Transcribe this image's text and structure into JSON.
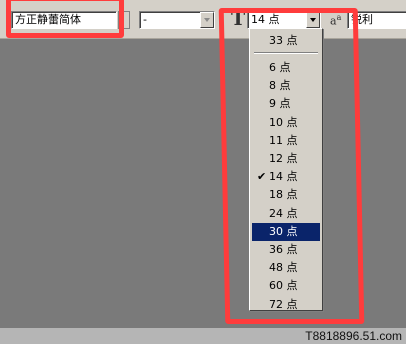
{
  "toolbar": {
    "font_family": "方正静蕾简体",
    "font_style": "-",
    "font_size": "14 点",
    "antialias_icon_label": "a",
    "antialias_icon_sup": "a",
    "antialias": "锐利"
  },
  "font_size_menu": {
    "top_item": "33 点",
    "items": [
      {
        "label": "6 点"
      },
      {
        "label": "8 点"
      },
      {
        "label": "9 点"
      },
      {
        "label": "10 点"
      },
      {
        "label": "11 点"
      },
      {
        "label": "12 点"
      },
      {
        "label": "14 点",
        "checked": true,
        "check_glyph": "✔"
      },
      {
        "label": "18 点"
      },
      {
        "label": "24 点"
      },
      {
        "label": "30 点",
        "highlighted": true
      },
      {
        "label": "36 点"
      },
      {
        "label": "48 点"
      },
      {
        "label": "60 点"
      },
      {
        "label": "72 点"
      }
    ]
  },
  "watermark": "T8818896.51.com",
  "colors": {
    "highlight_outline": "#ff3c3c",
    "menu_selection": "#0a246a",
    "workspace": "#7a7a7a"
  }
}
